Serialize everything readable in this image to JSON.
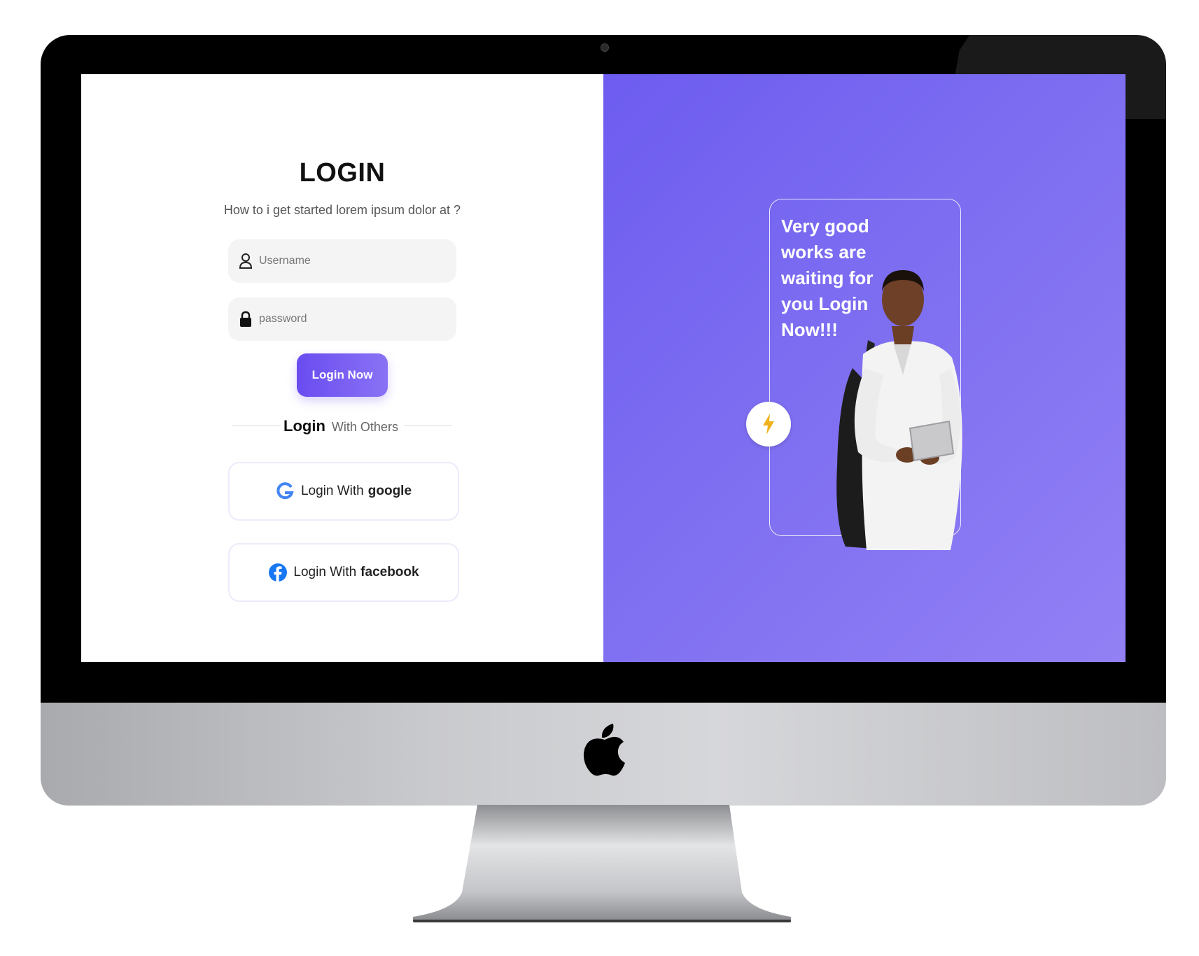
{
  "login": {
    "title": "LOGIN",
    "subtitle": "How to i get started lorem ipsum dolor at ?",
    "username_placeholder": "Username",
    "password_placeholder": "password",
    "submit_label": "Login Now",
    "divider_bold": "Login",
    "divider_rest": "With Others",
    "google_prefix": "Login With",
    "google_name": "google",
    "facebook_prefix": "Login With",
    "facebook_name": "facebook"
  },
  "promo": {
    "text": "Very good works are waiting for you Login Now!!!"
  },
  "icons": {
    "user": "user-icon",
    "lock": "lock-icon",
    "google": "google-icon",
    "facebook": "facebook-icon",
    "bolt": "lightning-bolt-icon",
    "apple": "apple-logo"
  },
  "colors": {
    "accent": "#6a4cf0",
    "panel": "#7d6ef1",
    "bolt": "#f0b21a",
    "google_blue": "#4285f4",
    "facebook_blue": "#1877f2"
  }
}
